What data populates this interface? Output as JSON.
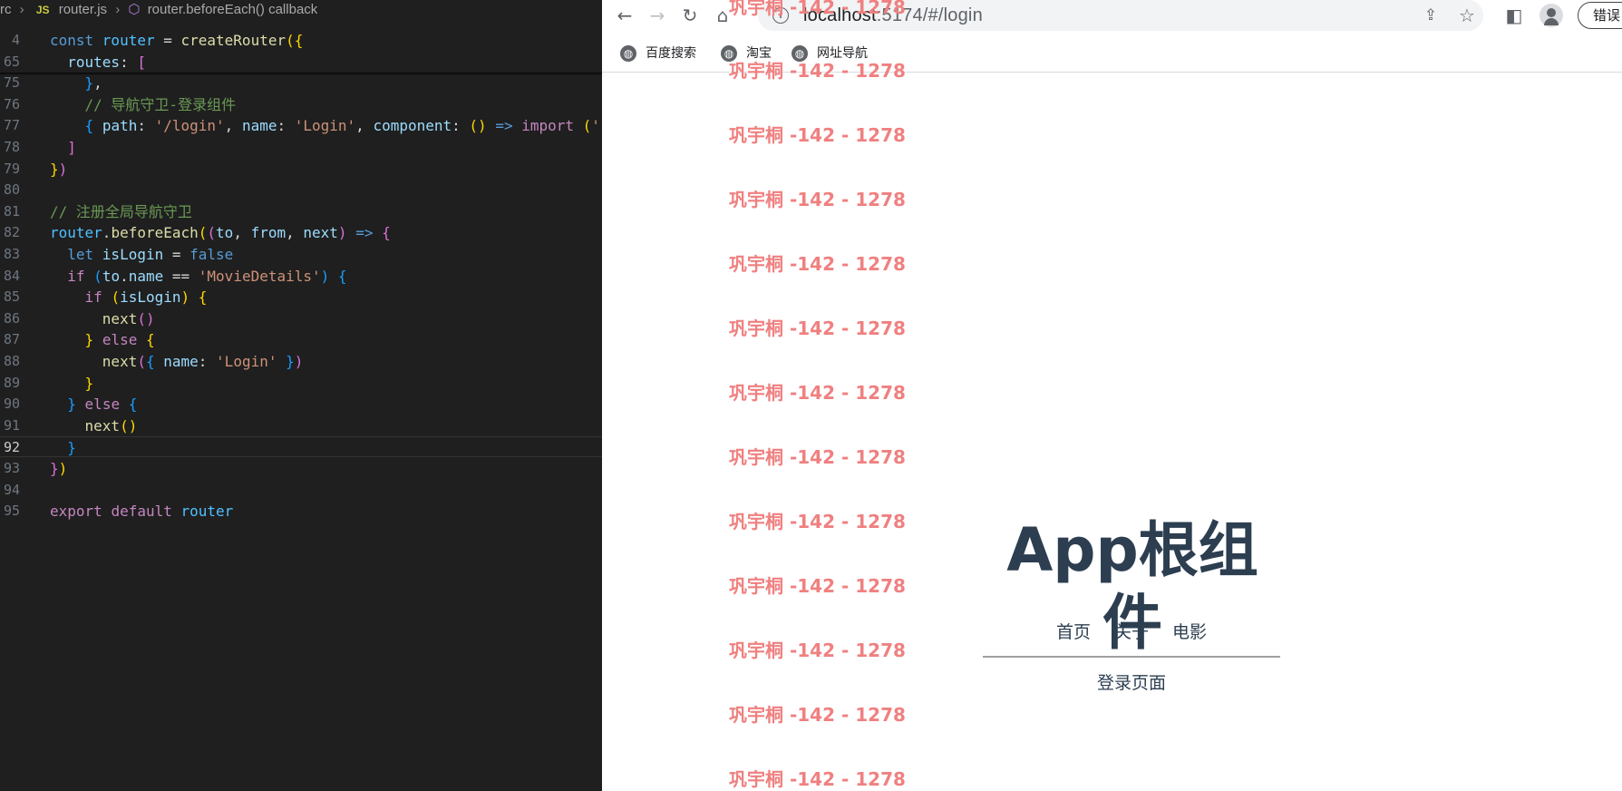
{
  "editor": {
    "breadcrumb": {
      "folder": "rc",
      "file_badge": "JS",
      "file": "router.js",
      "symbol": "router.beforeEach() callback"
    },
    "lines": [
      {
        "n": "4",
        "tokens": [
          [
            "k",
            "const "
          ],
          [
            "v",
            "router"
          ],
          [
            "w",
            " = "
          ],
          [
            "f",
            "createRouter"
          ],
          [
            "b1",
            "({"
          ]
        ]
      },
      {
        "n": "65",
        "tokens": [
          [
            "w",
            "  "
          ],
          [
            "p",
            "routes"
          ],
          [
            "w",
            ": "
          ],
          [
            "b2",
            "["
          ]
        ]
      },
      {
        "n": "75",
        "tokens": [
          [
            "w",
            "    "
          ],
          [
            "b3",
            "}"
          ],
          [
            "w",
            ","
          ]
        ]
      },
      {
        "n": "76",
        "tokens": [
          [
            "w",
            "    "
          ],
          [
            "c",
            "// 导航守卫-登录组件"
          ]
        ]
      },
      {
        "n": "77",
        "tokens": [
          [
            "w",
            "    "
          ],
          [
            "b3",
            "{"
          ],
          [
            "w",
            " "
          ],
          [
            "p",
            "path"
          ],
          [
            "w",
            ": "
          ],
          [
            "s",
            "'/login'"
          ],
          [
            "w",
            ", "
          ],
          [
            "p",
            "name"
          ],
          [
            "w",
            ": "
          ],
          [
            "s",
            "'Login'"
          ],
          [
            "w",
            ", "
          ],
          [
            "p",
            "component"
          ],
          [
            "w",
            ": "
          ],
          [
            "b1",
            "()"
          ],
          [
            "w",
            " "
          ],
          [
            "k",
            "=>"
          ],
          [
            "w",
            " "
          ],
          [
            "kc",
            "import"
          ],
          [
            "w",
            " "
          ],
          [
            "b1",
            "("
          ],
          [
            "s",
            "'"
          ]
        ]
      },
      {
        "n": "78",
        "tokens": [
          [
            "w",
            "  "
          ],
          [
            "b2",
            "]"
          ]
        ]
      },
      {
        "n": "79",
        "tokens": [
          [
            "b1",
            "}"
          ],
          [
            "b2",
            ")"
          ]
        ]
      },
      {
        "n": "80",
        "tokens": []
      },
      {
        "n": "81",
        "tokens": [
          [
            "c",
            "// 注册全局导航守卫"
          ]
        ]
      },
      {
        "n": "82",
        "tokens": [
          [
            "v",
            "router"
          ],
          [
            "w",
            "."
          ],
          [
            "f",
            "beforeEach"
          ],
          [
            "b1",
            "("
          ],
          [
            "b2",
            "("
          ],
          [
            "p",
            "to"
          ],
          [
            "w",
            ", "
          ],
          [
            "p",
            "from"
          ],
          [
            "w",
            ", "
          ],
          [
            "p",
            "next"
          ],
          [
            "b2",
            ")"
          ],
          [
            "w",
            " "
          ],
          [
            "k",
            "=>"
          ],
          [
            "w",
            " "
          ],
          [
            "b2",
            "{"
          ]
        ]
      },
      {
        "n": "83",
        "tokens": [
          [
            "w",
            "  "
          ],
          [
            "k",
            "let "
          ],
          [
            "p",
            "isLogin"
          ],
          [
            "w",
            " = "
          ],
          [
            "k",
            "false"
          ]
        ]
      },
      {
        "n": "84",
        "tokens": [
          [
            "w",
            "  "
          ],
          [
            "kc",
            "if"
          ],
          [
            "w",
            " "
          ],
          [
            "b3",
            "("
          ],
          [
            "p",
            "to"
          ],
          [
            "w",
            "."
          ],
          [
            "p",
            "name"
          ],
          [
            "w",
            " == "
          ],
          [
            "s",
            "'MovieDetails'"
          ],
          [
            "b3",
            ")"
          ],
          [
            "w",
            " "
          ],
          [
            "b3",
            "{"
          ]
        ]
      },
      {
        "n": "85",
        "tokens": [
          [
            "w",
            "    "
          ],
          [
            "kc",
            "if"
          ],
          [
            "w",
            " "
          ],
          [
            "b1",
            "("
          ],
          [
            "p",
            "isLogin"
          ],
          [
            "b1",
            ")"
          ],
          [
            "w",
            " "
          ],
          [
            "b1",
            "{"
          ]
        ]
      },
      {
        "n": "86",
        "tokens": [
          [
            "w",
            "      "
          ],
          [
            "f",
            "next"
          ],
          [
            "b2",
            "()"
          ]
        ]
      },
      {
        "n": "87",
        "tokens": [
          [
            "w",
            "    "
          ],
          [
            "b1",
            "}"
          ],
          [
            "w",
            " "
          ],
          [
            "kc",
            "else"
          ],
          [
            "w",
            " "
          ],
          [
            "b1",
            "{"
          ]
        ]
      },
      {
        "n": "88",
        "tokens": [
          [
            "w",
            "      "
          ],
          [
            "f",
            "next"
          ],
          [
            "b2",
            "("
          ],
          [
            "b3",
            "{"
          ],
          [
            "w",
            " "
          ],
          [
            "p",
            "name"
          ],
          [
            "w",
            ": "
          ],
          [
            "s",
            "'Login'"
          ],
          [
            "w",
            " "
          ],
          [
            "b3",
            "}"
          ],
          [
            "b2",
            ")"
          ]
        ]
      },
      {
        "n": "89",
        "tokens": [
          [
            "w",
            "    "
          ],
          [
            "b1",
            "}"
          ]
        ]
      },
      {
        "n": "90",
        "tokens": [
          [
            "w",
            "  "
          ],
          [
            "b3",
            "}"
          ],
          [
            "w",
            " "
          ],
          [
            "kc",
            "else"
          ],
          [
            "w",
            " "
          ],
          [
            "b3",
            "{"
          ]
        ]
      },
      {
        "n": "91",
        "tokens": [
          [
            "w",
            "    "
          ],
          [
            "f",
            "next"
          ],
          [
            "b1",
            "()"
          ]
        ]
      },
      {
        "n": "92",
        "tokens": [
          [
            "w",
            "  "
          ],
          [
            "b3",
            "}"
          ]
        ]
      },
      {
        "n": "93",
        "tokens": [
          [
            "b2",
            "}"
          ],
          [
            "b1",
            ")"
          ]
        ]
      },
      {
        "n": "94",
        "tokens": []
      },
      {
        "n": "95",
        "tokens": [
          [
            "kc",
            "export"
          ],
          [
            "w",
            " "
          ],
          [
            "kc",
            "default"
          ],
          [
            "w",
            " "
          ],
          [
            "v",
            "router"
          ]
        ]
      }
    ],
    "current_line": "92"
  },
  "browser": {
    "url_host": "localhost",
    "url_rest": ":5174/#/login",
    "bookmarks": [
      "百度搜索",
      "淘宝",
      "网址导航"
    ],
    "profile_chip": "错误"
  },
  "watermark": "巩宇桐 -142 - 1278",
  "page": {
    "title": "App根组件",
    "nav": [
      "首页",
      "关于",
      "电影"
    ],
    "content": "登录页面"
  },
  "icons": {
    "back": "arrow-left-icon",
    "forward": "arrow-right-icon",
    "reload": "reload-icon",
    "home": "home-icon",
    "info": "info-icon",
    "share": "share-icon",
    "star": "star-icon",
    "sidepanel": "side-panel-icon",
    "avatar": "profile-icon",
    "globe": "globe-icon",
    "cube": "cube-icon"
  }
}
